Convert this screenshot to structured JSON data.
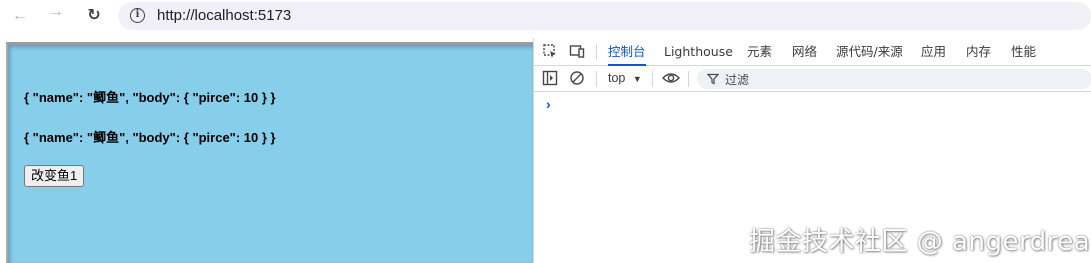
{
  "browser": {
    "url": "http://localhost:5173",
    "icons": [
      "back-icon",
      "forward-icon",
      "reload-icon",
      "info-icon"
    ]
  },
  "page": {
    "line1": "{ \"name\": \"鲫鱼\", \"body\": { \"pirce\": 10 } }",
    "line2": "{ \"name\": \"鲫鱼\", \"body\": { \"pirce\": 10 } }",
    "button_label": "改变鱼1",
    "background": "#87ceeb"
  },
  "devtools": {
    "tabs": [
      "控制台",
      "Lighthouse",
      "元素",
      "网络",
      "源代码/来源",
      "应用",
      "内存",
      "性能"
    ],
    "active_tab": "控制台",
    "context": "top",
    "filter_label": "过滤",
    "prompt": "›",
    "accent": "#0b57d0"
  },
  "watermark": "掘金技术社区 @ angerdream"
}
